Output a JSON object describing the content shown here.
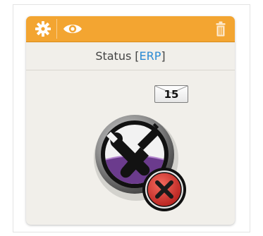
{
  "widget": {
    "title_prefix": "Status",
    "tag_open": "[",
    "tag": "ERP",
    "tag_close": "]",
    "notification_count": "15",
    "status": "error"
  },
  "toolbar": {
    "icons": [
      "gear-icon",
      "eye-icon",
      "trash-icon"
    ]
  },
  "colors": {
    "toolbar": "#f3a531",
    "tag": "#2a8ad4",
    "error": "#d8322f",
    "purple": "#6b3b8d"
  }
}
